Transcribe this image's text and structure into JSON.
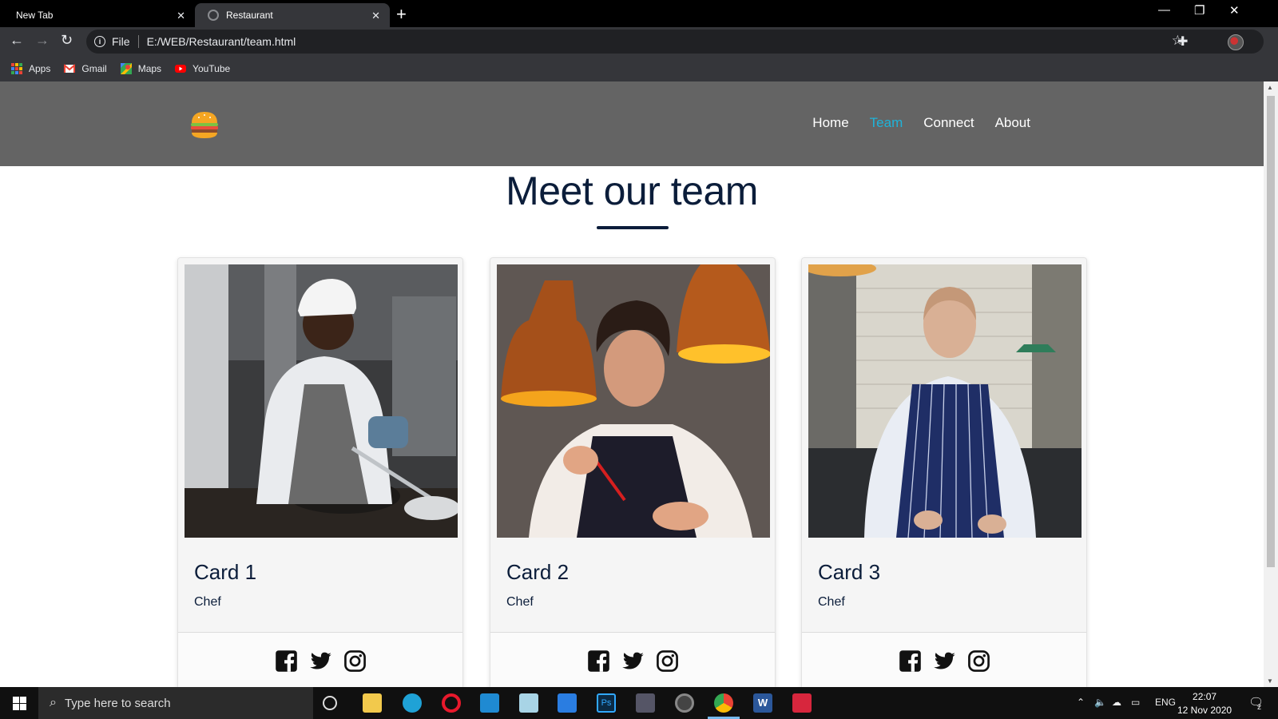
{
  "browser": {
    "tabs": [
      {
        "title": "New Tab",
        "active": false
      },
      {
        "title": "Restaurant",
        "active": true
      }
    ],
    "address": {
      "scheme_label": "File",
      "url": "E:/WEB/Restaurant/team.html"
    },
    "bookmarks": [
      {
        "label": "Apps",
        "icon": "apps-grid-icon"
      },
      {
        "label": "Gmail",
        "icon": "gmail-icon"
      },
      {
        "label": "Maps",
        "icon": "maps-icon"
      },
      {
        "label": "YouTube",
        "icon": "youtube-icon"
      }
    ]
  },
  "site": {
    "logo_icon": "burger-icon",
    "nav": [
      {
        "label": "Home",
        "active": false
      },
      {
        "label": "Team",
        "active": true
      },
      {
        "label": "Connect",
        "active": false
      },
      {
        "label": "About",
        "active": false
      }
    ],
    "nav_active_color": "#1fb3d9",
    "header_color": "#646464",
    "title": "Meet our team",
    "cards": [
      {
        "title": "Card 1",
        "role": "Chef",
        "photo": "chef-in-white-cap-photo"
      },
      {
        "title": "Card 2",
        "role": "Chef",
        "photo": "chef-under-copper-lamps-photo"
      },
      {
        "title": "Card 3",
        "role": "Chef",
        "photo": "chef-in-striped-apron-photo"
      }
    ],
    "social_icons": [
      "facebook-icon",
      "twitter-icon",
      "instagram-icon"
    ]
  },
  "taskbar": {
    "search_placeholder": "Type here to search",
    "language": "ENG",
    "time": "22:07",
    "date": "12 Nov 2020",
    "notification_count": "2"
  }
}
